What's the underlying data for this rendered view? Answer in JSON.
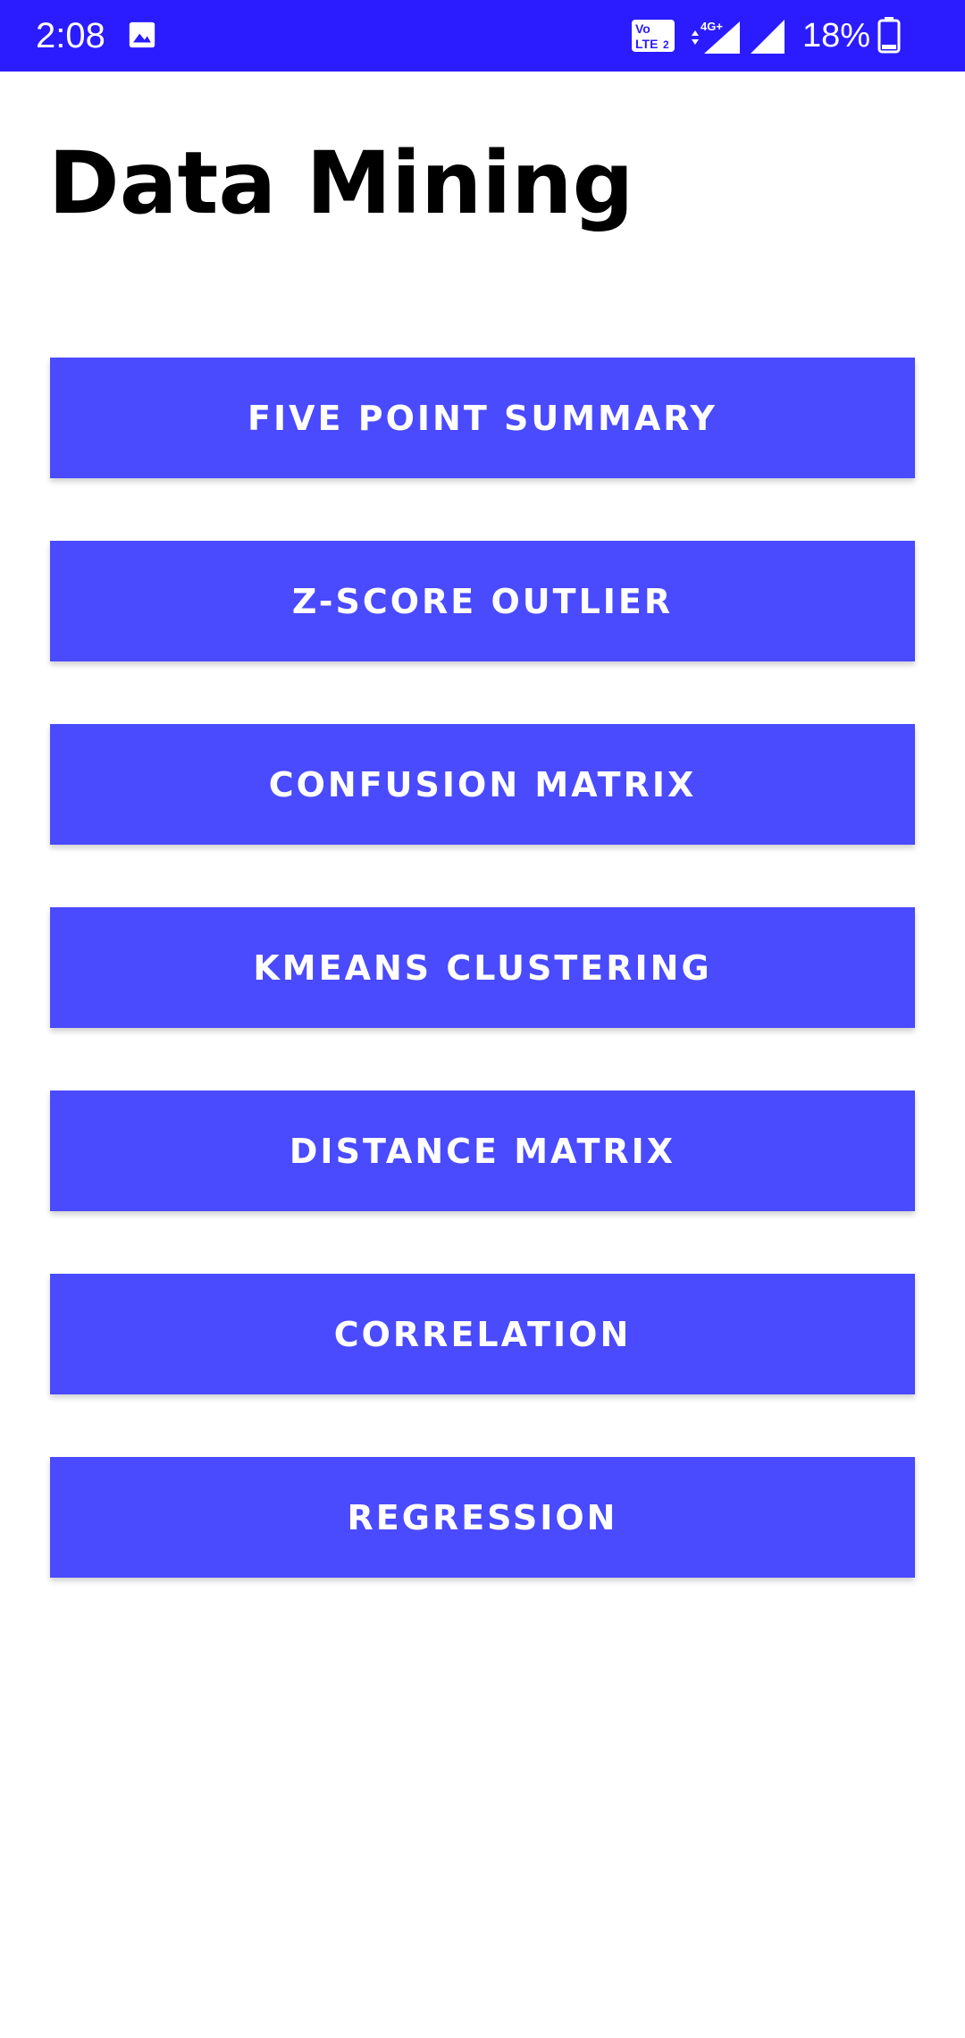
{
  "status_bar": {
    "time": "2:08",
    "battery_percent": "18%",
    "volte_label": "Vo LTE 2",
    "network_label": "4G+",
    "background_color": "#2a1cff"
  },
  "page": {
    "title": "Data Mining"
  },
  "menu": {
    "button_color": "#4a4aff",
    "items": [
      {
        "label": "FIVE POINT SUMMARY"
      },
      {
        "label": "Z-SCORE OUTLIER"
      },
      {
        "label": "CONFUSION MATRIX"
      },
      {
        "label": "KMEANS CLUSTERING"
      },
      {
        "label": "DISTANCE MATRIX"
      },
      {
        "label": "CORRELATION"
      },
      {
        "label": "REGRESSION"
      }
    ]
  },
  "icons": [
    "image-icon",
    "volte-icon",
    "signal-4g-icon",
    "signal-icon",
    "battery-icon"
  ]
}
